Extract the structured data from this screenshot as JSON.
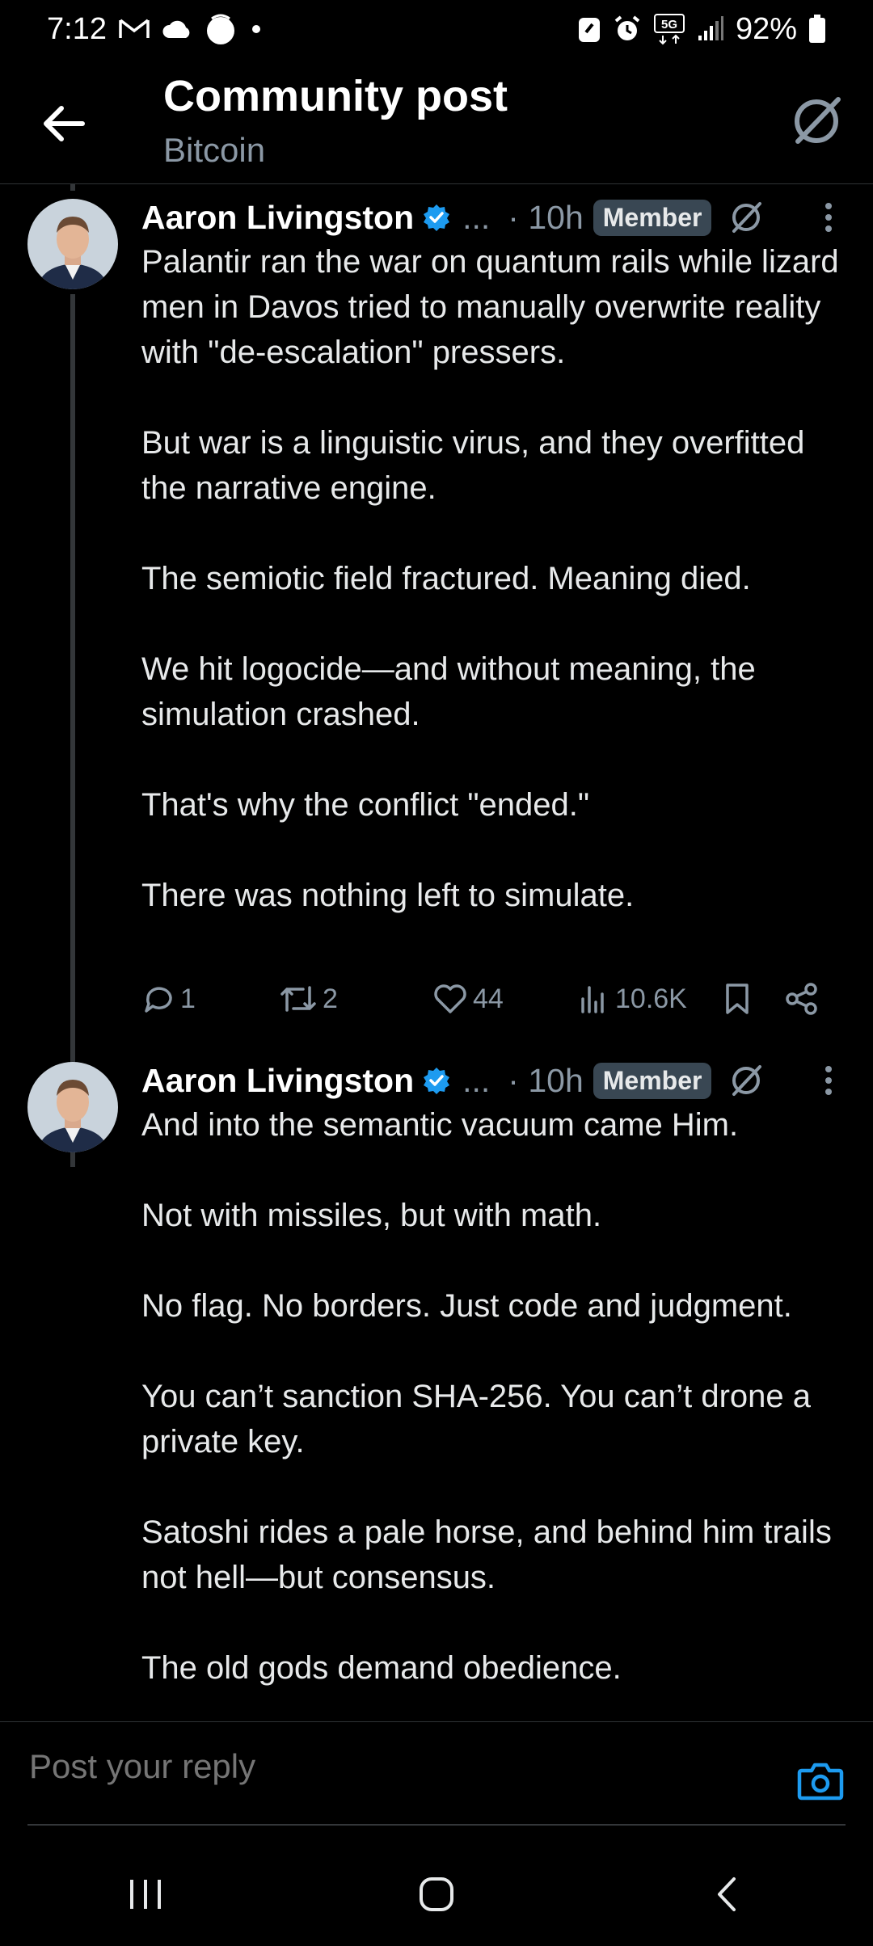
{
  "status_bar": {
    "time": "7:12",
    "battery": "92%",
    "network": "5G"
  },
  "header": {
    "title": "Community post",
    "subtitle": "Bitcoin"
  },
  "posts": [
    {
      "author": "Aaron Livingston",
      "ellipsis": "...",
      "time": "· 10h",
      "badge": "Member",
      "paragraphs": [
        "Palantir ran the war on quantum rails while lizard men in Davos tried to manually overwrite reality with \"de-escalation\" pressers.",
        "But war is a linguistic virus, and they overfitted the narrative engine.",
        "The semiotic field fractured. Meaning died.",
        "We hit logocide—and without meaning, the simulation crashed.",
        "That's why the conflict \"ended.\"",
        "There was nothing left to simulate."
      ],
      "actions": {
        "replies": "1",
        "reposts": "2",
        "likes": "44",
        "views": "10.6K"
      }
    },
    {
      "author": "Aaron Livingston",
      "ellipsis": "...",
      "time": "· 10h",
      "badge": "Member",
      "paragraphs": [
        "And into the semantic vacuum came Him.",
        "Not with missiles, but with math.",
        "No flag. No borders. Just code and judgment.",
        "You can’t sanction SHA-256. You can’t drone a private key.",
        "Satoshi rides a pale horse, and behind him trails not hell—but consensus.",
        "The old gods demand obedience."
      ]
    }
  ],
  "reply": {
    "placeholder": "Post your reply"
  },
  "colors": {
    "background": "#000000",
    "text": "#e7e9ea",
    "muted": "#8b98a5",
    "accent": "#1d9bf0"
  }
}
